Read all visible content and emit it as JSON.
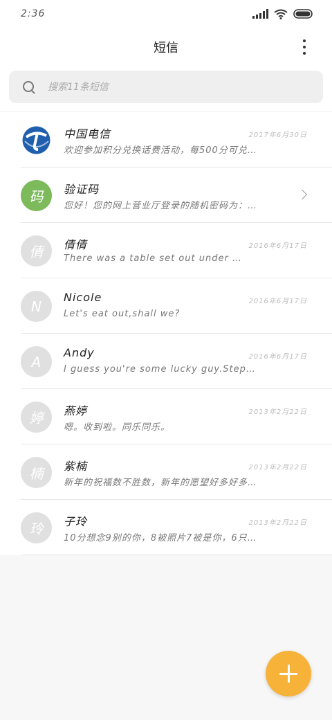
{
  "status_bar": {
    "time": "2:36",
    "icons": [
      "signal-icon",
      "wifi-icon",
      "battery-icon"
    ]
  },
  "header": {
    "title": "短信",
    "more_icon": "more-vertical-icon"
  },
  "search": {
    "placeholder": "搜索11条短信",
    "icon": "search-icon"
  },
  "messages": [
    {
      "avatar": "",
      "avatar_type": "telecom-logo",
      "sender": "中国电信",
      "preview": "欢迎参加积分兑换话费活动，每500分可兑…",
      "date": "2017年6月30日"
    },
    {
      "avatar": "码",
      "avatar_type": "green",
      "sender": "验证码",
      "preview": "您好！您的网上营业厅登录的随机密码为：…",
      "date": ""
    },
    {
      "avatar": "倩",
      "avatar_type": "gray",
      "sender": "倩倩",
      "preview": "There was a table set out under …",
      "date": "2016年6月17日"
    },
    {
      "avatar": "N",
      "avatar_type": "gray",
      "sender": "Nicole",
      "preview": "Let's eat out,shall we?",
      "date": "2016年6月17日"
    },
    {
      "avatar": "A",
      "avatar_type": "gray",
      "sender": "Andy",
      "preview": "I guess you're some lucky guy.Step…",
      "date": "2016年6月17日"
    },
    {
      "avatar": "婷",
      "avatar_type": "gray",
      "sender": "燕婷",
      "preview": "嗯。收到啦。同乐同乐。",
      "date": "2013年2月22日"
    },
    {
      "avatar": "楠",
      "avatar_type": "gray",
      "sender": "紫楠",
      "preview": "新年的祝福数不胜数，新年的愿望好多好多…",
      "date": "2013年2月22日"
    },
    {
      "avatar": "玲",
      "avatar_type": "gray",
      "sender": "子玲",
      "preview": "10分想念9别的你，8被照片7被是你，6只…",
      "date": "2013年2月22日"
    }
  ],
  "fab": {
    "icon": "plus-icon",
    "color": "#f7b23a"
  },
  "colors": {
    "accent": "#f7b23a",
    "verification_avatar": "#7cba5b",
    "telecom_blue": "#1f5fae"
  }
}
